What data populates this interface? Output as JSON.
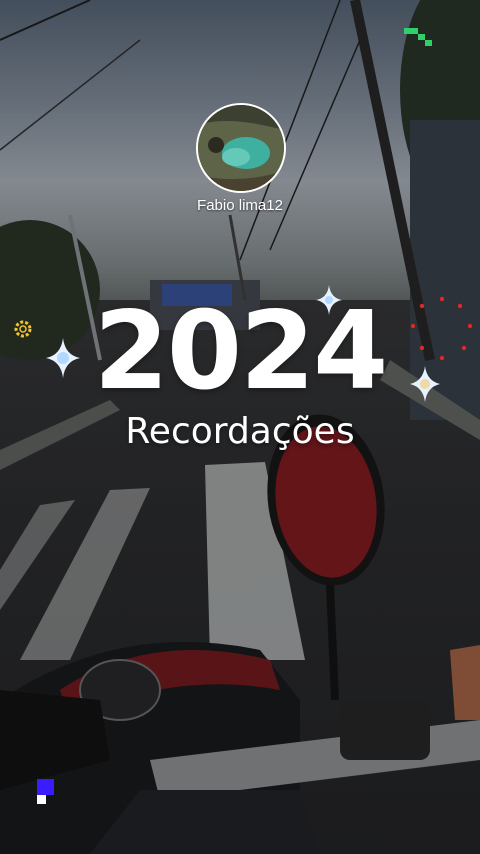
{
  "profile": {
    "username": "Fabio lima12",
    "avatar_icon": "profile-photo-icon"
  },
  "memories": {
    "year": "2024",
    "title": "Recordações"
  },
  "decorations": {
    "sparkle_color": "#e8f2ff",
    "sparkle_glow": "#8fc7ff",
    "gold_ring_color": "#f2c230",
    "red_dots_color": "#e02828",
    "green_pixel_color": "#2fd06a",
    "blue_pixel_color": "#3a1cff"
  }
}
